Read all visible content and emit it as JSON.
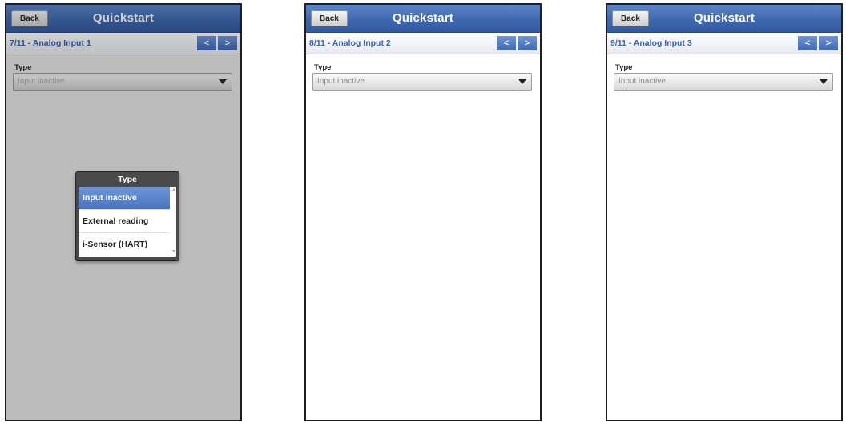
{
  "screens": [
    {
      "back_label": "Back",
      "title": "Quickstart",
      "step": "7/11 - Analog Input 1",
      "prev_label": "<",
      "next_label": ">",
      "field_label": "Type",
      "field_value": "Input inactive",
      "popup": {
        "title": "Type",
        "options": [
          "Input inactive",
          "External reading",
          "i-Sensor (HART)"
        ],
        "selected": "Input inactive"
      }
    },
    {
      "back_label": "Back",
      "title": "Quickstart",
      "step": "8/11 - Analog Input 2",
      "prev_label": "<",
      "next_label": ">",
      "field_label": "Type",
      "field_value": "Input inactive"
    },
    {
      "back_label": "Back",
      "title": "Quickstart",
      "step": "9/11 - Analog Input 3",
      "prev_label": "<",
      "next_label": ">",
      "field_label": "Type",
      "field_value": "Input inactive"
    }
  ],
  "colors": {
    "titlebar": "#3f68b0",
    "accent": "#3b63b0",
    "selected_item": "#4a74c0",
    "dim_overlay": "#bcbcbc"
  },
  "icons": {
    "dropdown": "chevron-down-icon",
    "prev": "chevron-left",
    "next": "chevron-right"
  }
}
